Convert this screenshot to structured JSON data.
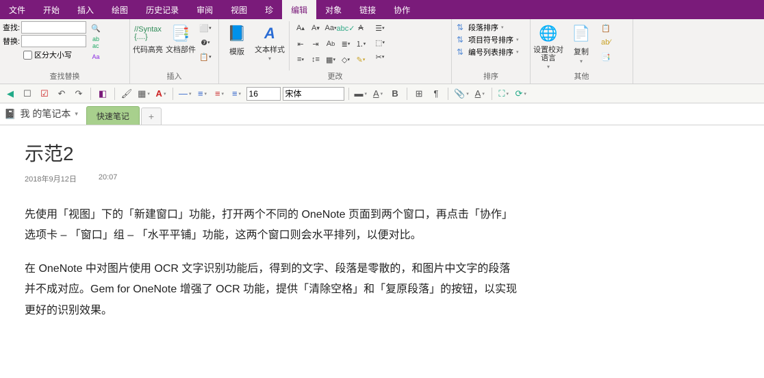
{
  "menu": [
    "文件",
    "开始",
    "插入",
    "绘图",
    "历史记录",
    "审阅",
    "视图",
    "珍",
    "编辑",
    "对象",
    "链接",
    "协作"
  ],
  "menu_active_index": 8,
  "ribbon": {
    "find": {
      "label_find": "查找:",
      "label_replace": "替换:",
      "case_label": "区分大小写",
      "group_title": "查找替换"
    },
    "insert": {
      "btns": [
        "代码高亮",
        "文档部件"
      ],
      "group_title": "插入"
    },
    "change": {
      "btns": [
        "模版",
        "文本样式"
      ],
      "group_title": "更改"
    },
    "sort": {
      "items": [
        "段落排序",
        "项目符号排序",
        "编号列表排序"
      ],
      "group_title": "排序"
    },
    "other": {
      "btns": [
        "设置校对语言",
        "复制"
      ],
      "group_title": "其他"
    }
  },
  "toolbar": {
    "font_size": "16",
    "font_name": "宋体"
  },
  "notebook": {
    "name": "我 的笔记本",
    "tab": "快速笔记"
  },
  "page": {
    "title": "示范2",
    "date": "2018年9月12日",
    "time": "20:07",
    "p1": "先使用「视图」下的「新建窗口」功能，打开两个不同的 OneNote 页面到两个窗口，再点击「协作」选项卡 – 「窗口」组 – 「水平平铺」功能，这两个窗口则会水平排列，以便对比。",
    "p2": "在 OneNote 中对图片使用 OCR 文字识别功能后，得到的文字、段落是零散的，和图片中文字的段落并不成对应。Gem for OneNote 增强了 OCR 功能，提供「清除空格」和「复原段落」的按钮，以实现更好的识别效果。"
  }
}
